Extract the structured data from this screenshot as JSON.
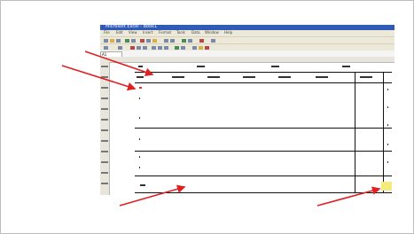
{
  "window": {
    "title": "Microsoft Excel - Book1"
  },
  "menus": [
    "File",
    "Edit",
    "View",
    "Insert",
    "Format",
    "Tools",
    "Data",
    "Window",
    "Help"
  ],
  "name_box": "A1",
  "colors": {
    "arrow": "#e02020",
    "highlight": "#f4ec7a",
    "titlebar": "#2f5bb7"
  },
  "annotation": {
    "arrow_count": 4,
    "icon": "red-arrow-icon"
  }
}
